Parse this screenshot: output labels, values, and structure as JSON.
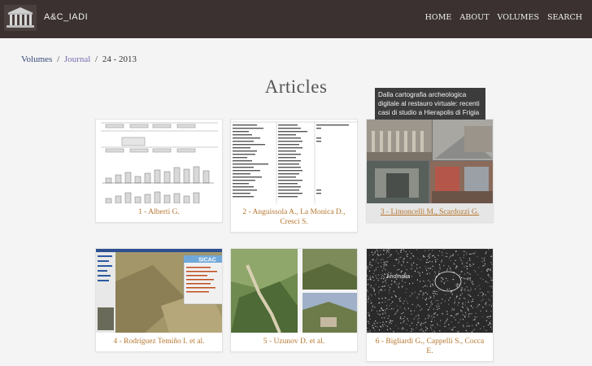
{
  "header": {
    "brand": "A&C_IADI",
    "logo_icon": "temple-logo-icon",
    "nav": [
      "HOME",
      "ABOUT",
      "VOLUMES",
      "SEARCH"
    ]
  },
  "breadcrumb": {
    "volumes": "Volumes",
    "sep1": "/",
    "journal": "Journal",
    "sep2": "/",
    "current": "24 - 2013"
  },
  "page_title": "Articles",
  "tooltip": "Dalla cartografia archeologica digitale al restauro virtuale: recenti casi di studio a Hierapolis di Frigia",
  "articles": [
    {
      "label": "1 - Alberti G."
    },
    {
      "label": "2 - Anguissola A., La Monica D., Cresci S."
    },
    {
      "label": "3 - Limoncelli M., Scardozzi G."
    },
    {
      "label": "4 - Rodriguez Temiño I. et al."
    },
    {
      "label": "5 - Uzunov D. et al."
    },
    {
      "label": "6 - Bigliardi G., Cappelli S., Cocca E."
    }
  ],
  "thumb_text": {
    "sicac": "SICAC",
    "anomaly": "Anomalia"
  },
  "colors": {
    "header_bg": "#3a3130",
    "link_accent": "#b5762f",
    "breadcrumb_link": "#3a4a7a"
  }
}
